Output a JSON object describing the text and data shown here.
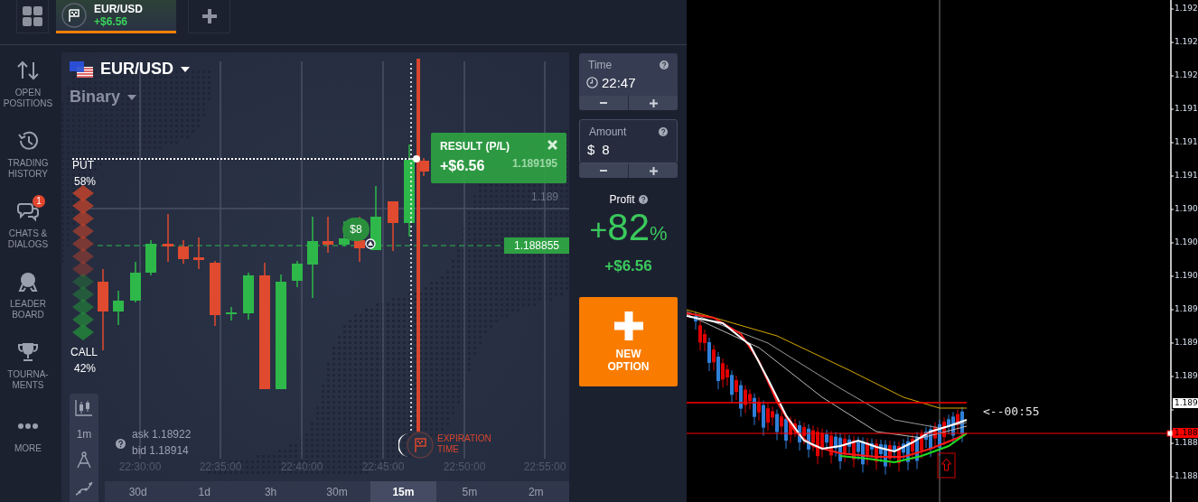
{
  "top_bar": {
    "asset_tab": {
      "title": "EUR/USD",
      "profit": "+$6.56",
      "selected": true
    }
  },
  "sidebar": {
    "items": [
      {
        "kind": "positions",
        "lines": [
          "OPEN",
          "POSITIONS"
        ]
      },
      {
        "kind": "history",
        "lines": [
          "TRADING",
          "HISTORY"
        ]
      },
      {
        "kind": "chats",
        "lines": [
          "CHATS &",
          "DIALOGS"
        ],
        "badge": "1"
      },
      {
        "kind": "leaderboard",
        "lines": [
          "LEADER",
          "BOARD"
        ]
      },
      {
        "kind": "tournaments",
        "lines": [
          "TOURNA-",
          "MENTS"
        ]
      },
      {
        "kind": "more",
        "lines": [
          "MORE"
        ]
      }
    ]
  },
  "chart": {
    "asset": "EUR/USD",
    "option_type": "Binary",
    "put": {
      "label": "PUT",
      "percent": "58%"
    },
    "call": {
      "label": "CALL",
      "percent": "42%"
    },
    "result": {
      "title": "RESULT (P/L)",
      "value": "+$6.56",
      "price": "1.189195"
    },
    "level_label": "1.189",
    "current_price": "1.188855",
    "investment": "$8",
    "expiration": [
      "EXPIRATION",
      "TIME"
    ],
    "ask": "ask 1.18922",
    "bid": "bid 1.18914",
    "time_axis": [
      "22:30:00",
      "22:35:00",
      "22:40:00",
      "22:45:00",
      "22:50:00",
      "22:55:00"
    ],
    "tools": [
      {
        "kind": "candles"
      },
      {
        "kind": "interval",
        "label": "1m"
      },
      {
        "kind": "compass"
      },
      {
        "kind": "indicators"
      }
    ],
    "periods": [
      {
        "label": "30d",
        "selected": false
      },
      {
        "label": "1d",
        "selected": false
      },
      {
        "label": "3h",
        "selected": false
      },
      {
        "label": "30m",
        "selected": false
      },
      {
        "label": "15m",
        "selected": true
      },
      {
        "label": "5m",
        "selected": false
      },
      {
        "label": "2m",
        "selected": false
      }
    ]
  },
  "trade_panel": {
    "time": {
      "label": "Time",
      "value": "22:47"
    },
    "amount": {
      "label": "Amount",
      "currency": "$",
      "value": "8"
    },
    "profit": {
      "label": "Profit",
      "sign": "+",
      "number": "82",
      "unit": "%",
      "value": "+$6.56"
    },
    "new_option": [
      "NEW",
      "OPTION"
    ]
  },
  "terminal": {
    "timer": "<--00:55",
    "axis_labels": [
      {
        "kind": "plain",
        "text": "1.192"
      },
      {
        "kind": "plain",
        "text": "1.192"
      },
      {
        "kind": "plain",
        "text": "1.192"
      },
      {
        "kind": "plain",
        "text": "1.191"
      },
      {
        "kind": "plain",
        "text": "1.191"
      },
      {
        "kind": "plain",
        "text": "1.191"
      },
      {
        "kind": "plain",
        "text": "1.190"
      },
      {
        "kind": "plain",
        "text": "1.190"
      },
      {
        "kind": "plain",
        "text": "1.190"
      },
      {
        "kind": "plain",
        "text": "1.189"
      },
      {
        "kind": "plain",
        "text": "1.189"
      },
      {
        "kind": "plain",
        "text": "1.189"
      },
      {
        "kind": "ask",
        "text": "1.189"
      },
      {
        "kind": "bid",
        "text": "1.188"
      },
      {
        "kind": "plain",
        "text": "1.188"
      },
      {
        "kind": "plain",
        "text": "1.188"
      }
    ]
  }
}
